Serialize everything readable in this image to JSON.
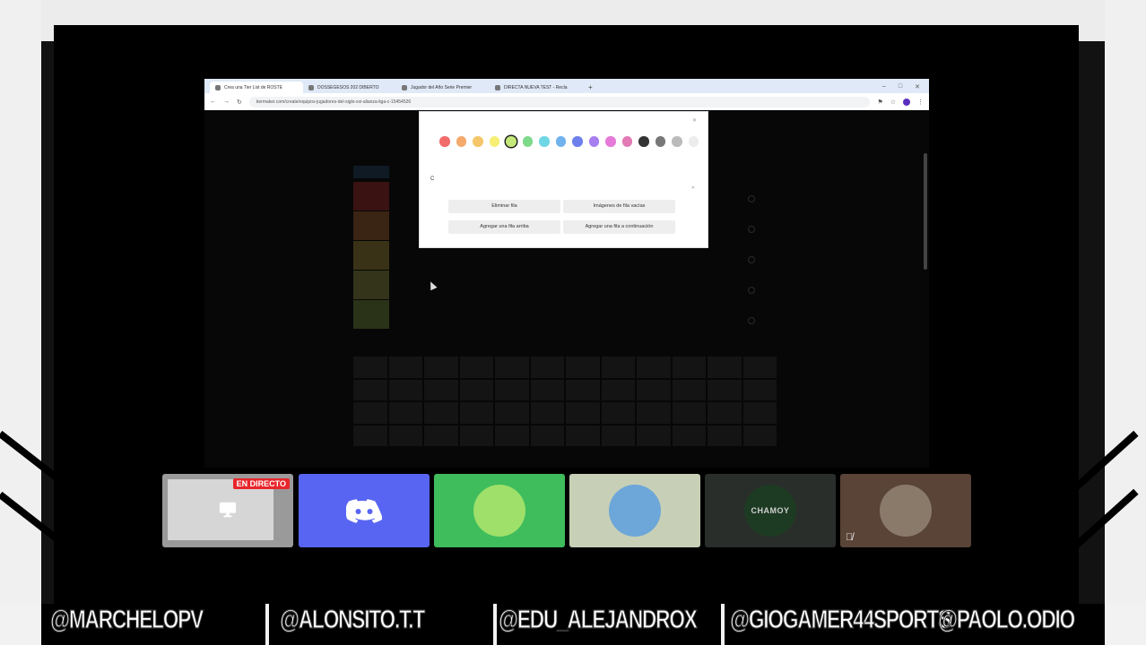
{
  "browser": {
    "tabs": [
      {
        "label": "Crea una Tier List de ROSTE"
      },
      {
        "label": "DOSSEGESOS 202 DIBERTO"
      },
      {
        "label": "Jugador del Año Serie Premier"
      },
      {
        "label": "DIRECTA NUEVA TEST - Recla"
      }
    ],
    "url": "tiermaker.com/create/equipos-jugadores-del-siglo-xxi-alianza-liga-c-15454526"
  },
  "modal": {
    "swatch_colors": [
      "#f26b6b",
      "#f5a96a",
      "#f5c66a",
      "#f7ef75",
      "#c4e87a",
      "#7fd98a",
      "#6fd6e4",
      "#6fb2ee",
      "#6e80ec",
      "#a77ef0",
      "#e57ad9",
      "#e27ab6",
      "#333333",
      "#777777",
      "#bbbbbb",
      "#ececec"
    ],
    "selected_swatch": 4,
    "label_value": "C",
    "buttons": {
      "delete_row": "Eliminar fila",
      "clear_images": "Imágenes de fila vacías",
      "add_row_above": "Agregar una fila arriba",
      "add_row_below": "Agregar una fila a continuación"
    }
  },
  "tiers": [
    {
      "color": "#3a1212"
    },
    {
      "color": "#3a2414"
    },
    {
      "color": "#3a3216"
    },
    {
      "color": "#33341a"
    },
    {
      "color": "#2a3318"
    }
  ],
  "call": {
    "tiles": [
      {
        "kind": "screen",
        "badge": "EN DIRECTO",
        "bg": "#9a9a9a"
      },
      {
        "kind": "discord",
        "bg": "#5865f2"
      },
      {
        "kind": "avatar",
        "bg": "#3fbd5c",
        "avatar_color": "#9ee06a"
      },
      {
        "kind": "avatar",
        "bg": "#c7d0b7",
        "avatar_color": "#6da6d8"
      },
      {
        "kind": "avatar",
        "bg": "#2a2e2b",
        "avatar_color": "#1d3a22",
        "text": "CHAMOY"
      },
      {
        "kind": "avatar",
        "bg": "#5a4337",
        "avatar_color": "#8a7a6a",
        "muted": true
      }
    ]
  },
  "handles": [
    "@MARCHELOPV",
    "@ALONSITO.T.T",
    "@EDU_ALEJANDROX",
    "@GIOGAMER44SPORTS",
    "@PAOLO.ODIO"
  ]
}
